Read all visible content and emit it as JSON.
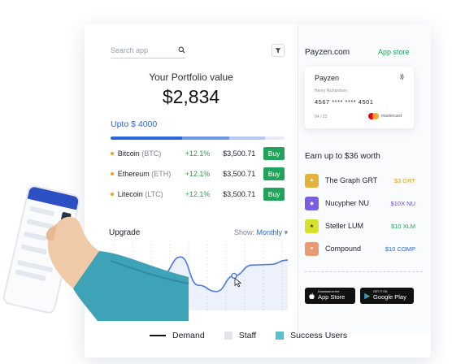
{
  "search": {
    "placeholder": "Search app"
  },
  "portfolio": {
    "label": "Your Portfolio value",
    "value": "$2,834",
    "limit_label": "Upto $ 4000"
  },
  "coins": [
    {
      "name": "Bitcoin",
      "ticker": "(BTC)",
      "change": "+12.1%",
      "price": "$3,500.71",
      "action": "Buy"
    },
    {
      "name": "Ethereum",
      "ticker": "(ETH)",
      "change": "+12.1%",
      "price": "$3,500.71",
      "action": "Buy"
    },
    {
      "name": "Litecoin",
      "ticker": "(LTC)",
      "change": "+12.1%",
      "price": "$3,500.71",
      "action": "Buy"
    }
  ],
  "upgrade": {
    "label": "Upgrade",
    "show_label": "Show:",
    "show_value": "Monthly"
  },
  "chart_data": {
    "type": "area",
    "points": [
      0.28,
      0.35,
      0.52,
      0.58,
      0.85,
      0.4,
      0.3,
      0.55,
      0.72,
      0.73,
      0.8
    ],
    "color": "#4a78dc"
  },
  "legend": [
    {
      "label": "Demand",
      "kind": "line",
      "color": "#111111"
    },
    {
      "label": "Staff",
      "kind": "square",
      "color": "#e3e5ea"
    },
    {
      "label": "Success Users",
      "kind": "square",
      "color": "#5bbfd0"
    }
  ],
  "right": {
    "site": "Payzen.com",
    "app_store_link": "App store",
    "card": {
      "brand": "Payzen",
      "holder": "Henry Richardson",
      "number": "4567 **** **** 4501",
      "expiry": "04 / 23",
      "network": "mastercard"
    },
    "earn_title": "Earn up to $36 worth",
    "tokens": [
      {
        "name": "The Graph GRT",
        "reward": "$3 GRT",
        "reward_color": "#e0a020",
        "icon_color": "#e3b23c",
        "icon": "graph-icon"
      },
      {
        "name": "Nucypher NU",
        "reward": "$10X NU",
        "reward_color": "#6a4fd0",
        "icon_color": "#7b5fe0",
        "icon": "nucypher-icon"
      },
      {
        "name": "Steller LUM",
        "reward": "$10 XLM",
        "reward_color": "#22a35a",
        "icon_color": "#d6e22a",
        "icon": "stellar-icon"
      },
      {
        "name": "Compound",
        "reward": "$10 COMP",
        "reward_color": "#2d66d6",
        "icon_color": "#e89a70",
        "icon": "compound-icon"
      }
    ],
    "app_store": {
      "small": "Download on the",
      "big": "App Store"
    },
    "google_play": {
      "small": "GET IT ON",
      "big": "Google Play"
    }
  }
}
